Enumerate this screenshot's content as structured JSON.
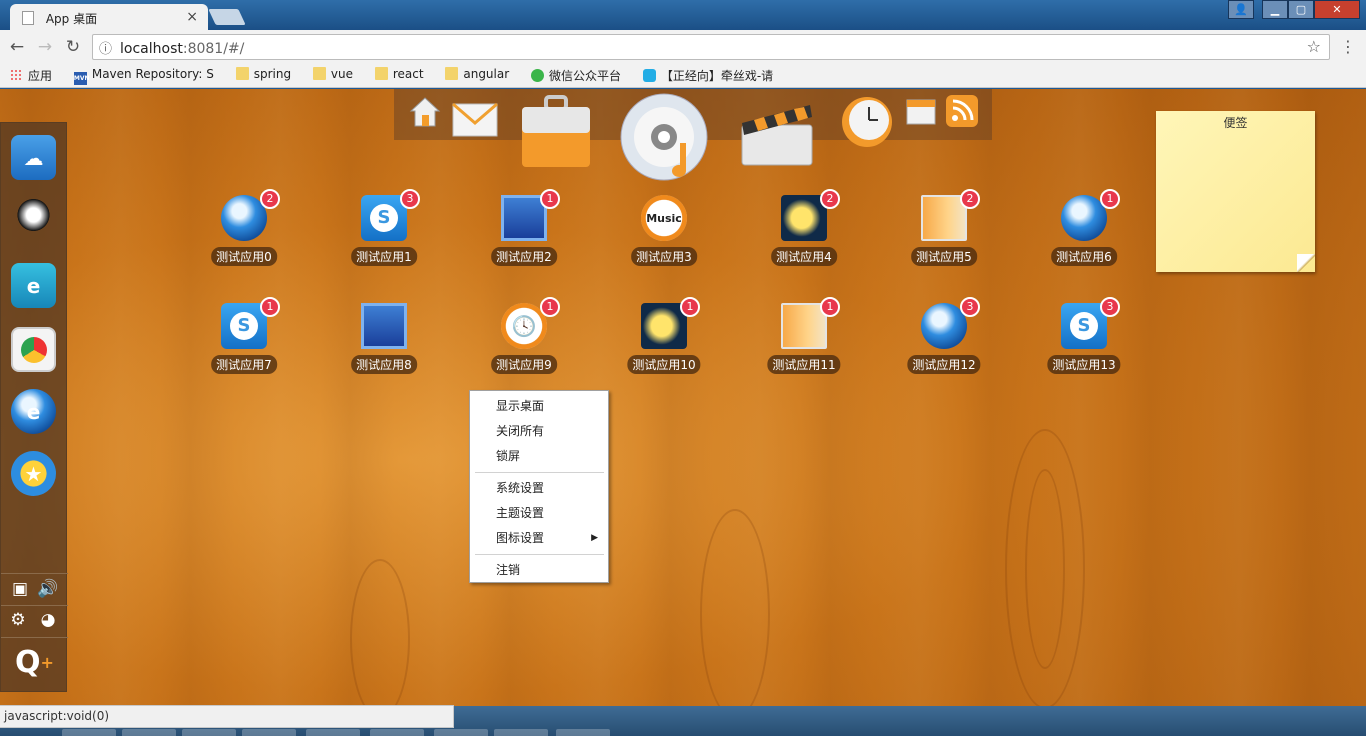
{
  "browser": {
    "tab_title": "App 桌面",
    "tab_close": "×",
    "url_host": "localhost",
    "url_rest": ":8081/#/",
    "info_icon": "ⓘ",
    "star": "☆",
    "menu": "⋮",
    "back": "←",
    "forward": "→",
    "reload": "↻",
    "bookmarks": [
      {
        "label": "应用",
        "icon": "apps-grid-icon"
      },
      {
        "label": "Maven Repository: S",
        "icon": "maven-icon"
      },
      {
        "label": "spring",
        "icon": "folder-icon"
      },
      {
        "label": "vue",
        "icon": "folder-icon"
      },
      {
        "label": "react",
        "icon": "folder-icon"
      },
      {
        "label": "angular",
        "icon": "folder-icon"
      },
      {
        "label": "微信公众平台",
        "icon": "wechat-icon"
      },
      {
        "label": "【正经向】牵丝戏-请",
        "icon": "bilibili-icon"
      }
    ],
    "status_text": "javascript:void(0)"
  },
  "dock": {
    "items": [
      "shop-icon",
      "qq-icon",
      "qq-browser-icon",
      "chrome-icon",
      "ie-icon",
      "qzone-icon"
    ]
  },
  "topbar": {
    "items": [
      "home-icon",
      "mail-icon",
      "briefcase-icon",
      "music-disc-icon",
      "film-clapper-icon",
      "clock-icon",
      "calendar-icon",
      "rss-icon"
    ]
  },
  "apps": [
    {
      "label": "测试应用0",
      "badge": "2",
      "icon": "ie"
    },
    {
      "label": "测试应用1",
      "badge": "3",
      "icon": "sogou"
    },
    {
      "label": "测试应用2",
      "badge": "1",
      "icon": "butterfly"
    },
    {
      "label": "测试应用3",
      "badge": "",
      "icon": "music"
    },
    {
      "label": "测试应用4",
      "badge": "2",
      "icon": "weather"
    },
    {
      "label": "测试应用5",
      "badge": "2",
      "icon": "folder"
    },
    {
      "label": "测试应用6",
      "badge": "1",
      "icon": "ie"
    },
    {
      "label": "测试应用7",
      "badge": "1",
      "icon": "sogou"
    },
    {
      "label": "测试应用8",
      "badge": "",
      "icon": "butterfly"
    },
    {
      "label": "测试应用9",
      "badge": "1",
      "icon": "clock"
    },
    {
      "label": "测试应用10",
      "badge": "1",
      "icon": "weather"
    },
    {
      "label": "测试应用11",
      "badge": "1",
      "icon": "folder"
    },
    {
      "label": "测试应用12",
      "badge": "3",
      "icon": "ie"
    },
    {
      "label": "测试应用13",
      "badge": "3",
      "icon": "sogou"
    }
  ],
  "icon_glyphs": {
    "sogou": "S",
    "music": "Music",
    "clock": "🕓"
  },
  "sticky_note": {
    "title": "便签"
  },
  "context_menu": {
    "items": [
      "显示桌面",
      "关闭所有",
      "锁屏",
      "系统设置",
      "主题设置",
      "图标设置",
      "注销"
    ],
    "submenu_arrow": "▶"
  }
}
